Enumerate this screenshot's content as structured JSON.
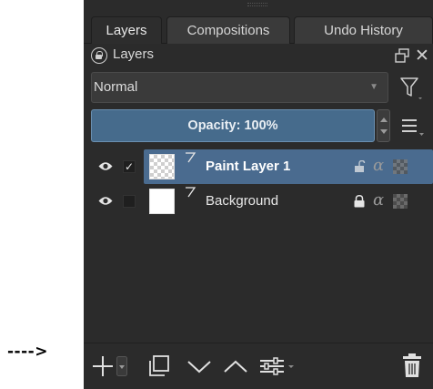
{
  "annotation": {
    "arrow_text": "---->"
  },
  "tabs": [
    {
      "label": "Layers",
      "active": true
    },
    {
      "label": "Compositions",
      "active": false
    },
    {
      "label": "Undo History",
      "active": false
    }
  ],
  "dock": {
    "title": "Layers",
    "lock_icon": "lock-circle-icon",
    "float_icon": "float-icon",
    "close_icon": "close-icon",
    "close_glyph": "✕"
  },
  "blending": {
    "value": "Normal",
    "dropdown_glyph": "▼"
  },
  "opacity": {
    "label": "Opacity:  100%",
    "value": 100
  },
  "layers": [
    {
      "name": "Paint Layer 1",
      "visible": true,
      "checked": true,
      "check_glyph": "✓",
      "selected": true,
      "thumbnail": "transparent",
      "locked": false,
      "alpha_glyph": "α"
    },
    {
      "name": "Background",
      "visible": true,
      "checked": false,
      "check_glyph": "",
      "selected": false,
      "thumbnail": "white",
      "locked": true,
      "alpha_glyph": "α"
    }
  ],
  "toolbar": [
    {
      "name": "add-layer-button",
      "icon": "plus-icon"
    },
    {
      "name": "add-layer-menu-button",
      "icon": "chevron-down-icon"
    },
    {
      "name": "duplicate-layer-button",
      "icon": "duplicate-icon"
    },
    {
      "name": "move-layer-down-button",
      "icon": "chevron-down-icon"
    },
    {
      "name": "move-layer-up-button",
      "icon": "chevron-up-icon"
    },
    {
      "name": "layer-properties-button",
      "icon": "sliders-icon"
    },
    {
      "name": "delete-layer-button",
      "icon": "trash-icon"
    }
  ],
  "colors": {
    "panel_bg": "#2b2b2b",
    "selection": "#4a6b8f",
    "opacity_bar": "#466b8c",
    "text": "#e8e8e8"
  }
}
